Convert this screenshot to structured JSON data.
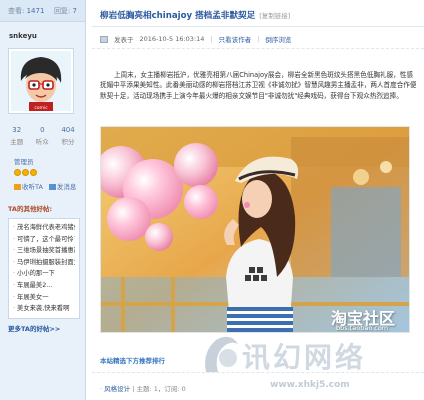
{
  "sidebar": {
    "stat_left_label": "查看:",
    "stat_left_value": "1471",
    "stat_right_label": "回复:",
    "stat_right_value": "7",
    "username": "snkeyu",
    "counts": [
      {
        "value": "32",
        "label": "主题"
      },
      {
        "value": "0",
        "label": "听众"
      },
      {
        "value": "404",
        "label": "积分"
      }
    ],
    "rank": "管理员",
    "actions": {
      "follow": "收听TA",
      "message": "发消息"
    },
    "favorites_title": "TA的其他好帖:",
    "favorites": [
      "茂名海鲜代表老鸡猪仔",
      "可憐了，这个最可怜了",
      "三维场景抽奖首播惠赢",
      "马伊琍拍摄服装封面大片",
      "小小的那一下",
      "车展最美2...",
      "年展美女一",
      "美女来袭,快来看啊"
    ],
    "more_link": "更多TA的好帖>>"
  },
  "post": {
    "title": "柳岩低胸亮相chinajoy 搭档孟非默契足",
    "copy_link": "[复制链接]",
    "meta": {
      "posted_prefix": "发表于",
      "posted_at": "2016-10-5 16:03:14",
      "author_only": "只看该作者",
      "reverse": "倒序浏览"
    },
    "body": "上周末，女主播柳岩抵沪，优雅亮相第八届Chinajoy展会，柳岩全新黑色斑纹头搭黑色低胸礼服，性感抚媚中平添果美知性。此番美丽动感的柳岩搭档江苏卫视《非诚勿扰》智慧风趣男主播孟非，两人首度合作便默契十足，活动现场携手上演今年最火爆的相亲文娱节目\"非诚勿扰\"经典戏码，获得台下观众热烈追捧。",
    "image_watermark": "淘宝社区",
    "image_watermark_url": "bbs.taobao.com",
    "recommend": "本站精选下方推荐排行",
    "category_label": "风格设计",
    "category_stats": "主题: 1，订阅: 0"
  },
  "site_watermark": {
    "name": "讯幻网络",
    "url": "www.xhkj5.com"
  },
  "colors": {
    "sidebar_bg": "#e8f1fa",
    "link": "#2a5aa0",
    "title": "#2a5aa0",
    "favorites_title": "#b04a2a"
  }
}
